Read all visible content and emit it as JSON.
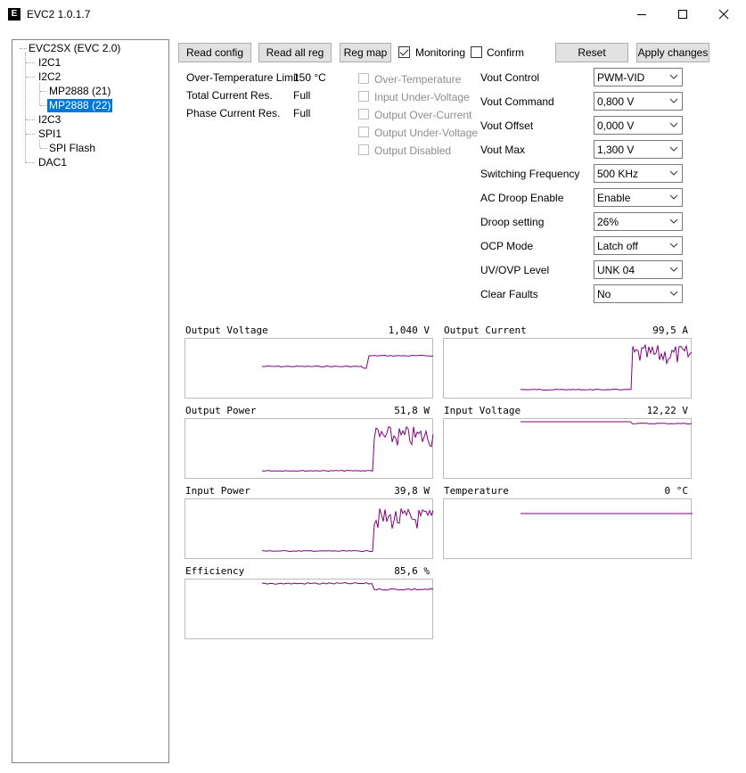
{
  "window": {
    "title": "EVC2 1.0.1.7",
    "icon": "evc2-logo-icon",
    "icon_text": "E"
  },
  "tree": {
    "items": [
      {
        "label": "EVC2SX (EVC 2.0)",
        "level": 0,
        "selected": false
      },
      {
        "label": "I2C1",
        "level": 1,
        "selected": false
      },
      {
        "label": "I2C2",
        "level": 1,
        "selected": false
      },
      {
        "label": "MP2888 (21)",
        "level": 2,
        "selected": false
      },
      {
        "label": "MP2888 (22)",
        "level": 2,
        "selected": true
      },
      {
        "label": "I2C3",
        "level": 1,
        "selected": false
      },
      {
        "label": "SPI1",
        "level": 1,
        "selected": false
      },
      {
        "label": "SPI Flash",
        "level": 2,
        "selected": false
      },
      {
        "label": "DAC1",
        "level": 1,
        "selected": false
      }
    ]
  },
  "toolbar": {
    "read_config": "Read config",
    "read_all_reg": "Read all reg",
    "reg_map": "Reg map",
    "monitoring_label": "Monitoring",
    "monitoring_checked": true,
    "confirm_label": "Confirm",
    "confirm_checked": false,
    "reset": "Reset",
    "apply_changes": "Apply changes"
  },
  "info": [
    {
      "label": "Over-Temperature Limit",
      "value": "150 °C"
    },
    {
      "label": "Total Current Res.",
      "value": "Full"
    },
    {
      "label": "Phase Current Res.",
      "value": "Full"
    }
  ],
  "flags": [
    {
      "label": "Over-Temperature",
      "checked": false
    },
    {
      "label": "Input Under-Voltage",
      "checked": false
    },
    {
      "label": "Output Over-Current",
      "checked": false
    },
    {
      "label": "Output Under-Voltage",
      "checked": false
    },
    {
      "label": "Output Disabled",
      "checked": false
    }
  ],
  "controls": [
    {
      "label": "Vout Control",
      "value": "PWM-VID"
    },
    {
      "label": "Vout Command",
      "value": "0,800 V"
    },
    {
      "label": "Vout Offset",
      "value": "0,000 V"
    },
    {
      "label": "Vout Max",
      "value": "1,300 V"
    },
    {
      "label": "Switching Frequency",
      "value": "500 KHz"
    },
    {
      "label": "AC Droop Enable",
      "value": "Enable"
    },
    {
      "label": "Droop setting",
      "value": "26%"
    },
    {
      "label": "OCP Mode",
      "value": "Latch off"
    },
    {
      "label": "UV/OVP Level",
      "value": "UNK 04"
    },
    {
      "label": "Clear Faults",
      "value": "No"
    }
  ],
  "graphs": [
    {
      "title": "Output Voltage",
      "value": "1,040 V",
      "line_color": "#800080"
    },
    {
      "title": "Output Current",
      "value": "99,5 A",
      "line_color": "#800080"
    },
    {
      "title": "Output Power",
      "value": "51,8 W",
      "line_color": "#800080"
    },
    {
      "title": "Input Voltage",
      "value": "12,22 V",
      "line_color": "#800080"
    },
    {
      "title": "Input Power",
      "value": "39,8 W",
      "line_color": "#800080"
    },
    {
      "title": "Temperature",
      "value": "0 °C",
      "line_color": "#800080"
    },
    {
      "title": "Efficiency",
      "value": "85,6 %",
      "line_color": "#800080"
    }
  ],
  "colors": {
    "selection": "#0078d7",
    "trace": "#800080",
    "button_face": "#e1e1e1"
  }
}
